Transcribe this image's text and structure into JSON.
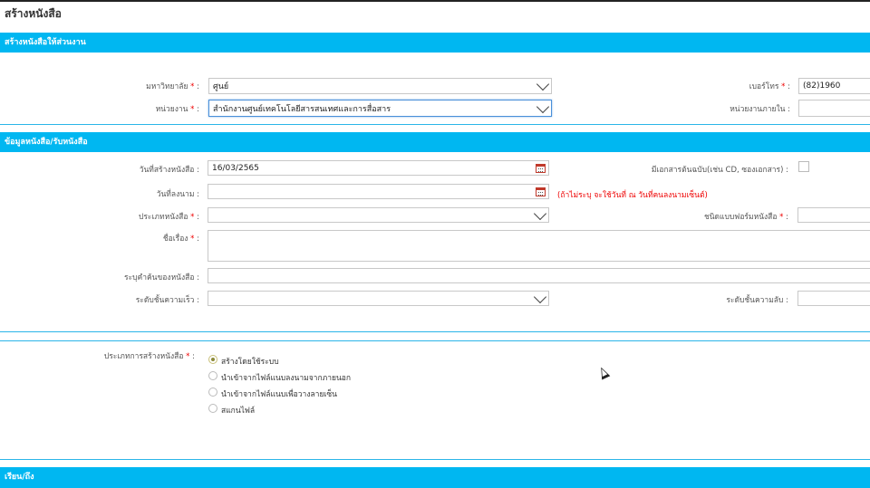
{
  "page": {
    "title": "สร้างหนังสือ"
  },
  "section1": {
    "header": "สร้างหนังสือให้ส่วนงาน",
    "university_label": "มหาวิทยาลัย",
    "university_value": "ศูนย์",
    "department_label": "หน่วยงาน",
    "department_value": "สำนักงานศูนย์เทคโนโลยีสารสนเทศและการสื่อสาร",
    "phone_label": "เบอร์โทร",
    "phone_value": "(82)1960",
    "internal_unit_label": "หน่วยงานภายใน",
    "required_mark": "*",
    "colon": ":"
  },
  "section2": {
    "header": "ข้อมูลหนังสือ/รับหนังสือ",
    "created_date_label": "วันที่สร้างหนังสือ",
    "created_date_value": "16/03/2565",
    "signed_date_label": "วันที่ลงนาม",
    "signed_date_note": "(ถ้าไม่ระบุ จะใช้วันที่ ณ วันที่คนลงนามเซ็นต์)",
    "has_original_label": "มีเอกสารต้นฉบับ(เช่น CD, ซองเอกสาร)",
    "doc_type_label": "ประเภทหนังสือ",
    "form_type_label": "ชนิดแบบฟอร์มหนังสือ",
    "subject_label": "ชื่อเรื่อง",
    "keywords_label": "ระบุคำค้นของหนังสือ",
    "urgency_label": "ระดับชั้นความเร็ว",
    "secrecy_label": "ระดับชั้นความลับ"
  },
  "section3": {
    "creation_type_label": "ประเภทการสร้างหนังสือ",
    "options": [
      {
        "label": "สร้างโดยใช้ระบบ",
        "selected": true
      },
      {
        "label": "นำเข้าจากไฟล์แนบลงนามจากภายนอก",
        "selected": false
      },
      {
        "label": "นำเข้าจากไฟล์แนบเพื่อวางลายเซ็น",
        "selected": false
      },
      {
        "label": "สแกนไฟล์",
        "selected": false
      }
    ]
  },
  "section4": {
    "header": "เรียน/ถึง"
  },
  "icons": {
    "dropdown": "chevron-down-icon",
    "calendar": "calendar-icon",
    "cursor": "mouse-cursor-icon"
  },
  "colors": {
    "header_bar": "#00b7f1",
    "required": "#ee0000"
  }
}
